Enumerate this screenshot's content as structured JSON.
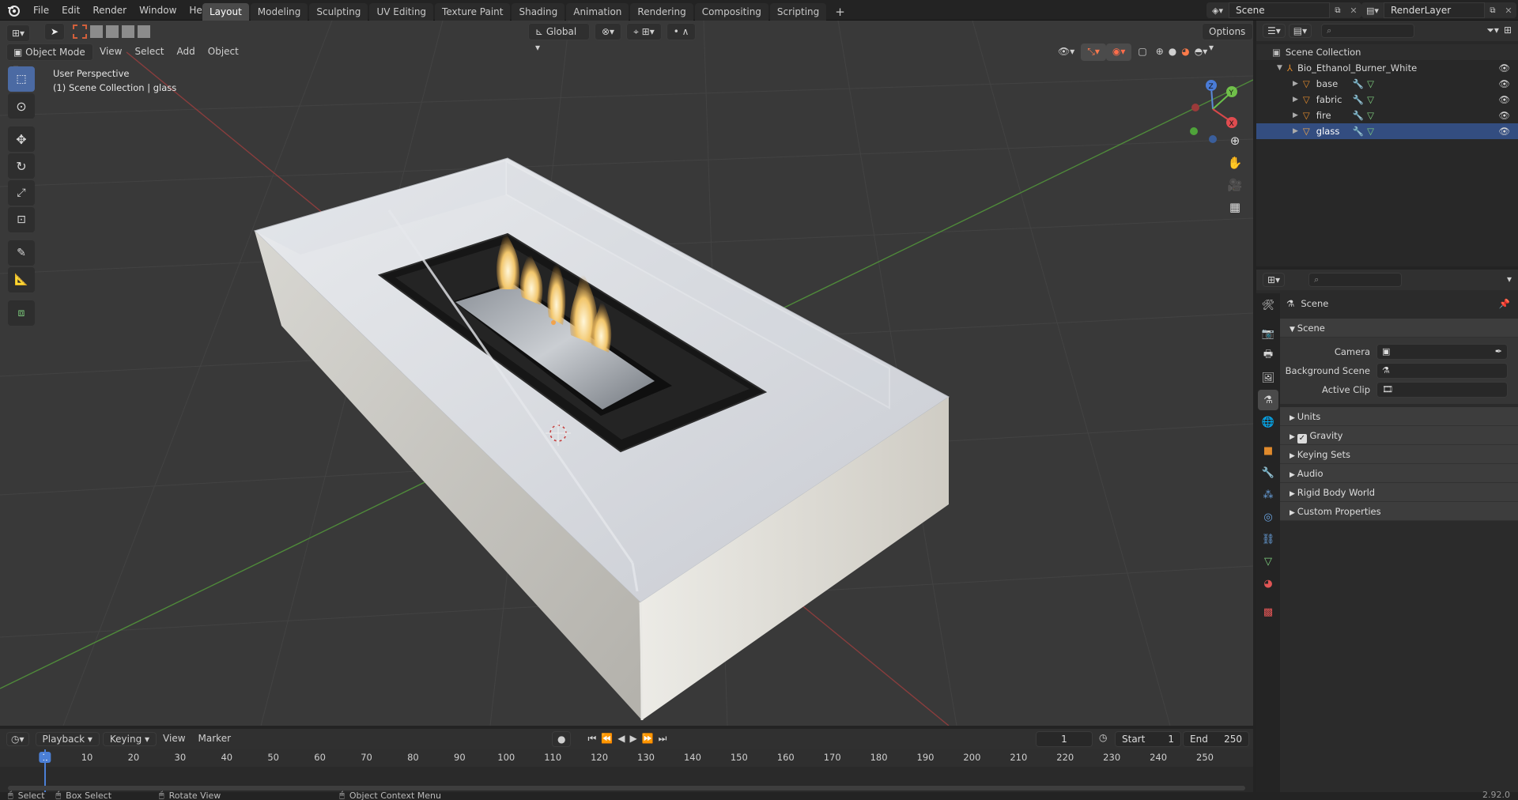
{
  "topbar": {
    "menus": [
      "File",
      "Edit",
      "Render",
      "Window",
      "Help"
    ],
    "workspaces": [
      "Layout",
      "Modeling",
      "Sculpting",
      "UV Editing",
      "Texture Paint",
      "Shading",
      "Animation",
      "Rendering",
      "Compositing",
      "Scripting"
    ],
    "active_workspace": "Layout",
    "add_tab": "+",
    "scene_name": "Scene",
    "view_layer": "RenderLayer"
  },
  "viewport": {
    "mode": "Object Mode",
    "menus": [
      "View",
      "Select",
      "Add",
      "Object"
    ],
    "transform_orientation": "Global",
    "options_label": "Options",
    "overlay_line1": "User Perspective",
    "overlay_line2": "(1) Scene Collection | glass",
    "gizmo": {
      "x": "X",
      "y": "Y",
      "z": "Z"
    }
  },
  "outliner": {
    "root": "Scene Collection",
    "collection": "Bio_Ethanol_Burner_White",
    "objects": [
      "base",
      "fabric",
      "fire",
      "glass"
    ]
  },
  "properties": {
    "title": "Scene",
    "panel": "Scene",
    "fields": [
      {
        "label": "Camera"
      },
      {
        "label": "Background Scene"
      },
      {
        "label": "Active Clip"
      }
    ],
    "subpanels": [
      "Units",
      "Gravity",
      "Keying Sets",
      "Audio",
      "Rigid Body World",
      "Custom Properties"
    ]
  },
  "timeline": {
    "menus": [
      "Playback",
      "Keying",
      "View",
      "Marker"
    ],
    "current_frame": "1",
    "start_label": "Start",
    "start": "1",
    "end_label": "End",
    "end": "250",
    "ticks": [
      "1",
      "10",
      "20",
      "30",
      "40",
      "50",
      "60",
      "70",
      "80",
      "90",
      "100",
      "110",
      "120",
      "130",
      "140",
      "150",
      "160",
      "170",
      "180",
      "190",
      "200",
      "210",
      "220",
      "230",
      "240",
      "250"
    ]
  },
  "statusbar": {
    "items": [
      "Select",
      "Box Select",
      "Rotate View",
      "Object Context Menu"
    ],
    "version": "2.92.0"
  },
  "colors": {
    "accent": "#4b6aa3",
    "active_tab": "#4a4a4a",
    "object_orange": "#e08a2c",
    "viewport_bg": "#393939"
  }
}
